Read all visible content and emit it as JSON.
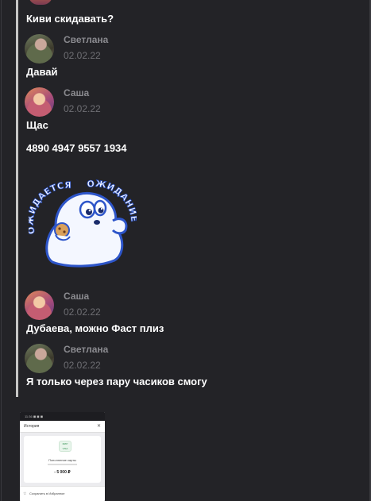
{
  "messages": [
    {
      "text": "Киви скидавать?"
    },
    {
      "author": "Светлана",
      "date": "02.02.22",
      "text": "Давай"
    },
    {
      "author": "Саша",
      "date": "02.02.22",
      "text": "Щас",
      "text2": "4890 4947 9557 1934",
      "sticker_text_left": "ОЖИДАЕТСЯ",
      "sticker_text_right": "ОЖИДАНИЕ"
    },
    {
      "author": "Саша",
      "date": "02.02.22",
      "text": "Дубаева, можно Фаст плиз"
    },
    {
      "author": "Светлана",
      "date": "02.02.22",
      "text": "Я только через пару часиков смогу"
    }
  ],
  "attachment": {
    "header_title": "История",
    "close_glyph": "✕",
    "status_left": "11:36 ◼ ◼ ◼",
    "card_logo": "МИР VISA",
    "card_title": "Пополнение карты",
    "card_amount": "- 5 000 ₽",
    "favorite_label": "Сохранить в Избранное",
    "star_glyph": "☆"
  },
  "colors": {
    "background": "#232327",
    "author": "#8b8b90",
    "date": "#6e6e73",
    "sticker_outline": "#2d55c9",
    "sticker_body": "#f4f7ff"
  }
}
